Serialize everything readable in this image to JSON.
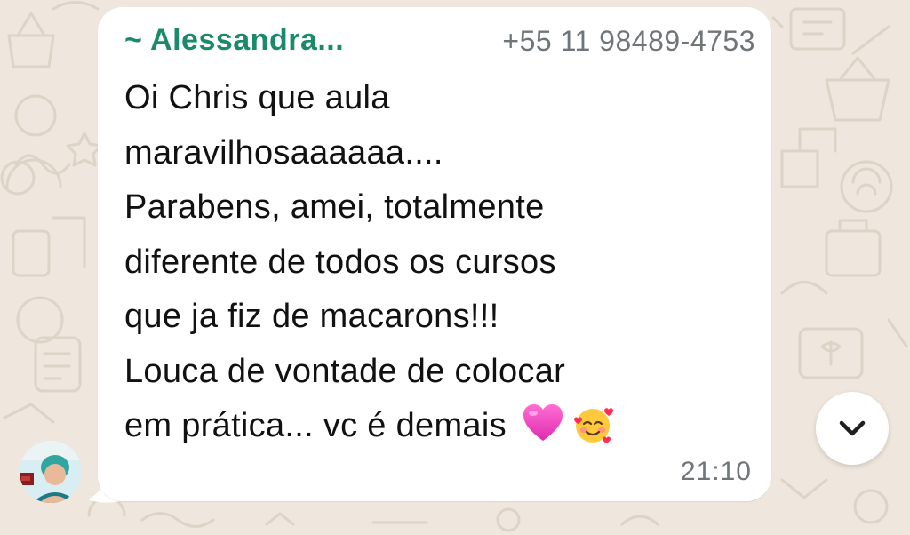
{
  "message": {
    "sender_name": "~ Alessandra...",
    "sender_phone": "+55 11 98489-4753",
    "lines": [
      "Oi Chris que aula",
      "maravilhosaaaaaa....",
      "Parabens, amei, totalmente",
      "diferente de todos os cursos",
      "que ja fiz de macarons!!!",
      "Louca de vontade de colocar",
      "em prática... vc é demais"
    ],
    "emojis": [
      "pink-heart-icon",
      "smiling-face-with-hearts-icon"
    ],
    "timestamp": "21:10"
  },
  "colors": {
    "sender_name": "#1b8a6b",
    "bubble": "#ffffff",
    "background": "#efe7dd",
    "meta_text": "#707579"
  },
  "controls": {
    "scroll_down_icon": "chevron-down-icon"
  }
}
